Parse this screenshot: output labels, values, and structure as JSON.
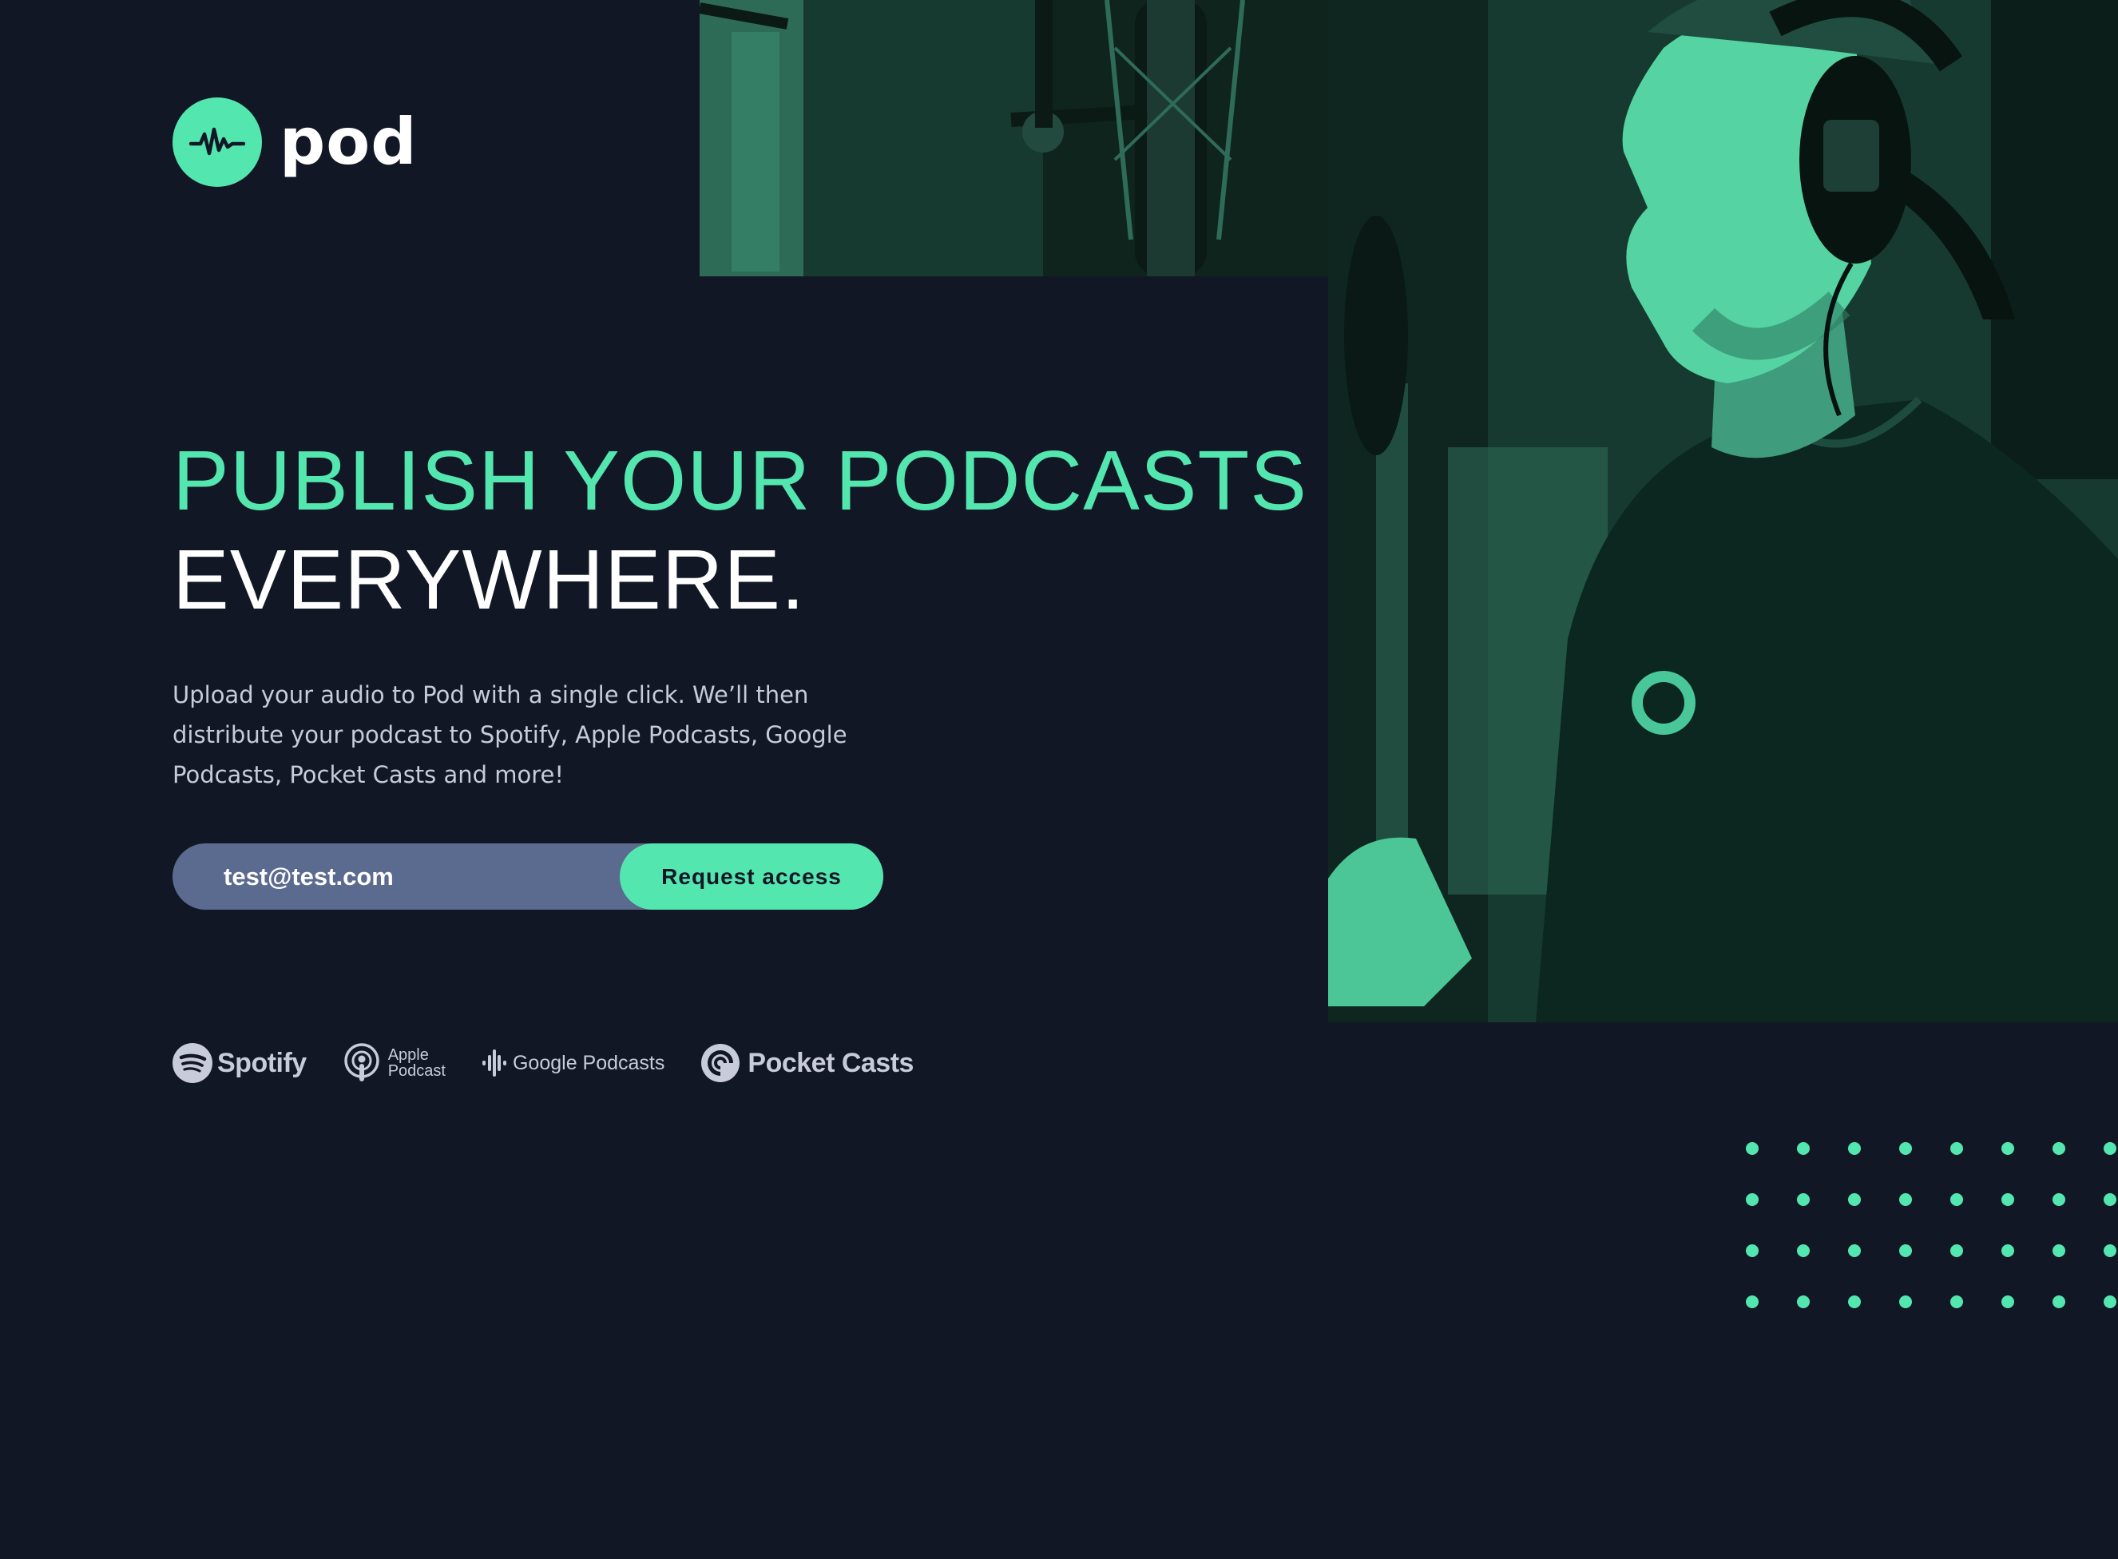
{
  "brand": {
    "name": "pod",
    "logo_icon": "sound-wave-icon",
    "accent_color": "#54e6af",
    "background_color": "#121725"
  },
  "hero": {
    "headline_line1": "PUBLISH YOUR PODCASTS",
    "headline_line2": "EVERYWHERE.",
    "description": "Upload your audio to Pod with a single click. We’ll then distribute your podcast to Spotify, Apple Podcasts, Google Podcasts, Pocket Casts and more!"
  },
  "signup": {
    "email_value": "test@test.com",
    "button_label": "Request access",
    "input_color": "#5b6a8f"
  },
  "partners": {
    "spotify": "Spotify",
    "apple_line1": "Apple",
    "apple_line2": "Podcast",
    "google": "Google Podcasts",
    "pocket_casts": "Pocket Casts"
  }
}
